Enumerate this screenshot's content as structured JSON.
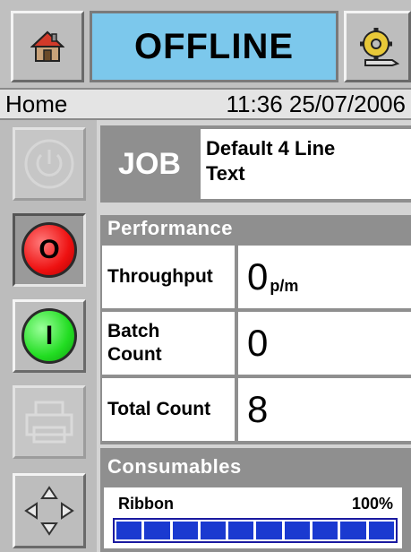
{
  "header": {
    "status": "OFFLINE",
    "home_icon": "home-icon",
    "settings_icon": "gear-wrench-icon"
  },
  "info": {
    "location": "Home",
    "datetime": "11:36 25/07/2006"
  },
  "side_buttons": [
    {
      "name": "power-button",
      "icon": "power-icon",
      "state": "disabled"
    },
    {
      "name": "stop-button",
      "label": "O",
      "color": "#ee1111",
      "state": "active"
    },
    {
      "name": "start-button",
      "label": "I",
      "color": "#22dd22",
      "state": "normal"
    },
    {
      "name": "print-button",
      "icon": "printer-icon",
      "state": "disabled"
    },
    {
      "name": "navigate-button",
      "icon": "arrows-icon",
      "state": "normal"
    }
  ],
  "job": {
    "label": "JOB",
    "name": "Default 4 Line\nText"
  },
  "performance": {
    "title": "Performance",
    "rows": [
      {
        "label": "Throughput",
        "value": "0",
        "unit": "p/m"
      },
      {
        "label": "Batch\nCount",
        "value": "0",
        "unit": ""
      },
      {
        "label": "Total Count",
        "value": "8",
        "unit": ""
      }
    ]
  },
  "consumables": {
    "title": "Consumables",
    "item": "Ribbon",
    "level_text": "100%",
    "level": 1.0,
    "bar_color": "#1a3ad0"
  }
}
